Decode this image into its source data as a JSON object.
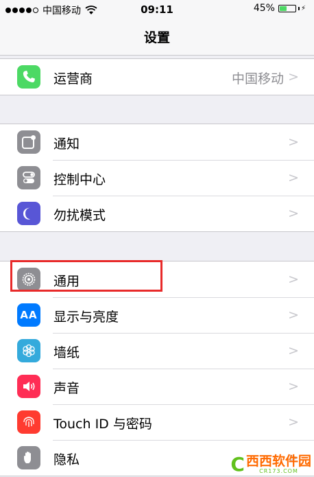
{
  "status_bar": {
    "carrier": "中国移动",
    "signal_filled": 4,
    "signal_total": 5,
    "time": "09:11",
    "battery_percent": "45%",
    "battery_level": 0.45,
    "colors": {
      "battery": "#4cd964"
    }
  },
  "nav": {
    "title": "设置"
  },
  "groups": [
    {
      "items": [
        {
          "label": "运营商",
          "value": "中国移动",
          "icon": "phone-icon",
          "color": "#4cd964"
        }
      ]
    },
    {
      "items": [
        {
          "label": "通知",
          "icon": "notifications-icon",
          "color": "#8e8e93"
        },
        {
          "label": "控制中心",
          "icon": "control-center-icon",
          "color": "#8e8e93"
        },
        {
          "label": "勿扰模式",
          "icon": "moon-icon",
          "color": "#5856d6"
        }
      ]
    },
    {
      "items": [
        {
          "label": "通用",
          "icon": "gear-icon",
          "color": "#8e8e93",
          "highlighted": true
        },
        {
          "label": "显示与亮度",
          "icon": "display-icon",
          "icon_text": "AA",
          "color": "#007aff"
        },
        {
          "label": "墙纸",
          "icon": "wallpaper-icon",
          "color": "#34aadc"
        },
        {
          "label": "声音",
          "icon": "speaker-icon",
          "color": "#ff2d55"
        },
        {
          "label": "Touch ID 与密码",
          "icon": "fingerprint-icon",
          "color": "#ff3b30"
        },
        {
          "label": "隐私",
          "icon": "hand-icon",
          "color": "#8e8e93"
        }
      ]
    }
  ],
  "highlight_color": "#e82a2a",
  "watermark": {
    "name": "西西软件园",
    "sub": "CR173.COM"
  }
}
